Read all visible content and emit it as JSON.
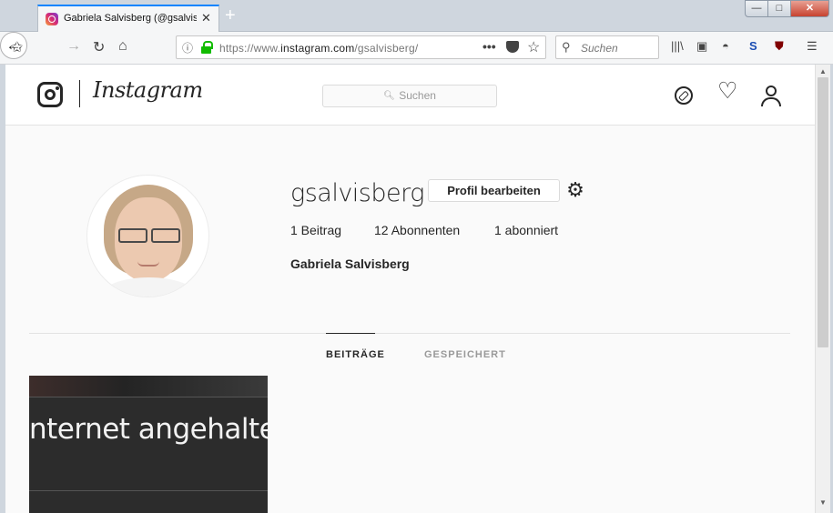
{
  "browser": {
    "tab_title": "Gabriela Salvisberg (@gsalvisb",
    "tab_close": "✕",
    "new_tab": "+",
    "url_prefix": "https://www.",
    "url_host": "instagram.com",
    "url_path": "/gsalvisberg/",
    "search_placeholder": "Suchen",
    "page_actions": "•••",
    "window_min": "—",
    "window_max": "□",
    "window_close": "✕"
  },
  "instagram": {
    "wordmark": "Instagram",
    "search_placeholder": "Suchen"
  },
  "profile": {
    "username": "gsalvisberg",
    "edit_button": "Profil bearbeiten",
    "posts": "1 Beitrag",
    "followers": "12 Abonnenten",
    "following": "1 abonniert",
    "full_name": "Gabriela Salvisberg"
  },
  "tabs": {
    "posts": "BEITRÄGE",
    "saved": "GESPEICHERT"
  },
  "post": {
    "thumbnail_text": "nternet angehalten"
  },
  "colors": {
    "accent_tab": "#0a84ff",
    "lock_green": "#12bc00",
    "text": "#262626",
    "muted": "#999999"
  },
  "icons": {
    "back": "arrow-left-icon",
    "forward": "arrow-right-icon",
    "reload": "reload-icon",
    "home": "home-icon",
    "compass": "compass-icon",
    "heart": "heart-icon",
    "person": "person-icon",
    "gear": "gear-icon"
  }
}
